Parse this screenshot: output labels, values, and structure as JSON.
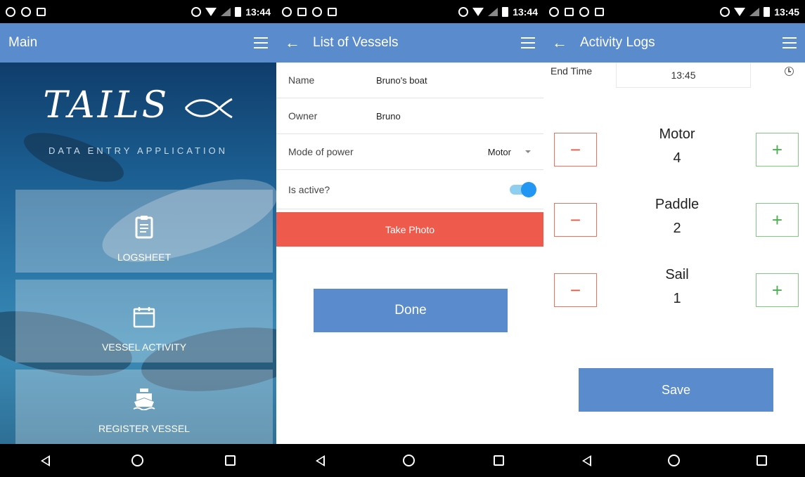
{
  "status": {
    "time_1": "13:44",
    "time_2": "13:44",
    "time_3": "13:45"
  },
  "screens": {
    "main": {
      "title": "Main",
      "logo": "TAILS",
      "subtitle": "DATA ENTRY APPLICATION",
      "tiles": [
        {
          "label": "LOGSHEET",
          "icon": "clipboard-icon"
        },
        {
          "label": "VESSEL ACTIVITY",
          "icon": "calendar-icon"
        },
        {
          "label": "REGISTER VESSEL",
          "icon": "ship-icon"
        }
      ]
    },
    "vessels": {
      "title": "List of Vessels",
      "fields": {
        "name_label": "Name",
        "name_value": "Bruno's boat",
        "owner_label": "Owner",
        "owner_value": "Bruno",
        "power_label": "Mode of power",
        "power_value": "Motor",
        "active_label": "Is active?",
        "active_value": true
      },
      "take_photo": "Take Photo",
      "done": "Done"
    },
    "activity": {
      "title": "Activity Logs",
      "end_time_label": "End Time",
      "end_time_value": "13:45",
      "counters": [
        {
          "name": "Motor",
          "value": "4"
        },
        {
          "name": "Paddle",
          "value": "2"
        },
        {
          "name": "Sail",
          "value": "1"
        }
      ],
      "minus_symbol": "−",
      "plus_symbol": "+",
      "save": "Save"
    }
  },
  "colors": {
    "appbar": "#5a8bcc",
    "take_photo": "#ee5a4c",
    "minus": "#e05a45",
    "plus": "#4caf50",
    "toggle": "#2196f3"
  }
}
